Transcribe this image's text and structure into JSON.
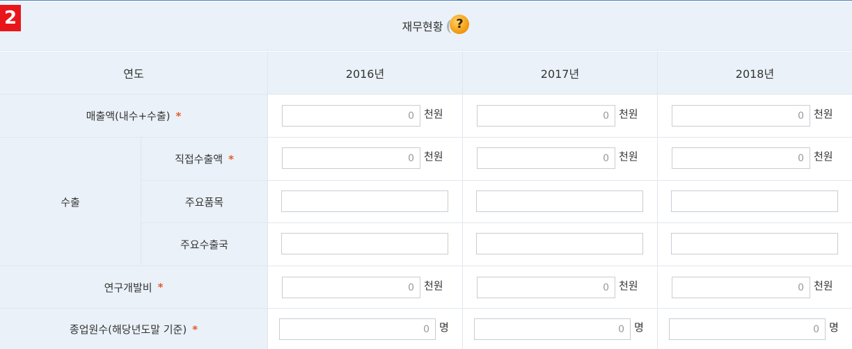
{
  "step_number": "2",
  "section_title": "재무현황",
  "help_icon_glyph": "?",
  "header": {
    "year_label": "연도",
    "years": [
      "2016년",
      "2017년",
      "2018년"
    ]
  },
  "rows": {
    "sales": {
      "label": "매출액(내수+수출)",
      "required": "*",
      "values": [
        "0",
        "0",
        "0"
      ],
      "unit": "천원"
    },
    "export_group_label": "수출",
    "direct_export": {
      "label": "직접수출액",
      "required": "*",
      "values": [
        "0",
        "0",
        "0"
      ],
      "unit": "천원"
    },
    "main_items": {
      "label": "주요품목",
      "values": [
        "",
        "",
        ""
      ]
    },
    "main_countries": {
      "label": "주요수출국",
      "values": [
        "",
        "",
        ""
      ]
    },
    "rnd": {
      "label": "연구개발비",
      "required": "*",
      "values": [
        "0",
        "0",
        "0"
      ],
      "unit": "천원"
    },
    "employees": {
      "label": "종업원수(해당년도말 기준)",
      "required": "*",
      "values": [
        "0",
        "0",
        "0"
      ],
      "unit": "명"
    }
  }
}
